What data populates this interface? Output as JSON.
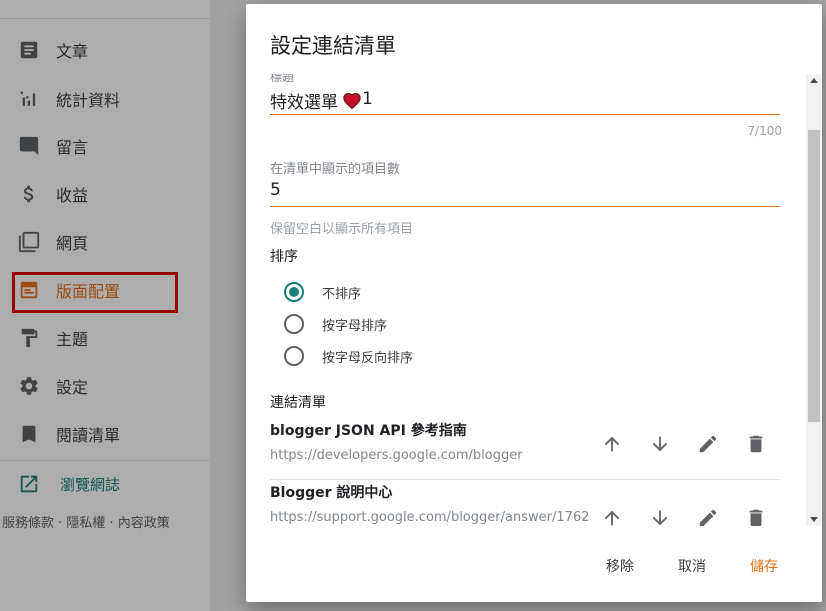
{
  "sidebar": {
    "items": [
      {
        "label": "文章",
        "icon": "post-icon"
      },
      {
        "label": "統計資料",
        "icon": "stats-icon"
      },
      {
        "label": "留言",
        "icon": "comment-icon"
      },
      {
        "label": "收益",
        "icon": "dollar-icon"
      },
      {
        "label": "網頁",
        "icon": "pages-icon"
      },
      {
        "label": "版面配置",
        "icon": "layout-icon",
        "active": true
      },
      {
        "label": "主題",
        "icon": "paint-roller-icon"
      },
      {
        "label": "設定",
        "icon": "gear-icon"
      },
      {
        "label": "閱讀清單",
        "icon": "bookmark-icon"
      }
    ],
    "view_blog": "瀏覽網誌",
    "footer": "服務條款 · 隱私權 · 內容政策"
  },
  "dialog": {
    "title": "設定連結清單",
    "title_field": {
      "label": "標題",
      "value": "特效選單",
      "suffix": "1",
      "counter": "7/100"
    },
    "count_field": {
      "label": "在清單中顯示的項目數",
      "value": "5",
      "hint": "保留空白以顯示所有項目"
    },
    "sort": {
      "label": "排序",
      "options": [
        {
          "label": "不排序",
          "checked": true
        },
        {
          "label": "按字母排序",
          "checked": false
        },
        {
          "label": "按字母反向排序",
          "checked": false
        }
      ]
    },
    "links": {
      "label": "連結清單",
      "items": [
        {
          "title": "blogger JSON API 參考指南",
          "url": "https://developers.google.com/blogger"
        },
        {
          "title": "Blogger 說明中心",
          "url": "https://support.google.com/blogger/answer/1762"
        }
      ]
    },
    "actions": {
      "remove": "移除",
      "cancel": "取消",
      "save": "儲存"
    }
  },
  "colors": {
    "accent": "#e8711a",
    "radio_checked": "#1a7f76",
    "highlight": "#e50000"
  }
}
